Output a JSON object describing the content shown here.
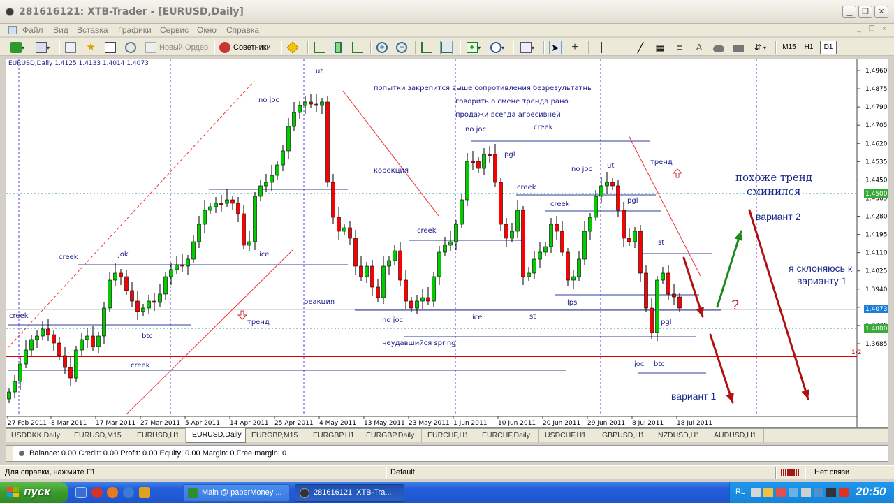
{
  "window": {
    "title": "281616121: XTB-Trader - [EURUSD,Daily]"
  },
  "menu": {
    "items": [
      "Файл",
      "Вид",
      "Вставка",
      "Графики",
      "Сервис",
      "Окно",
      "Справка"
    ]
  },
  "toolbar": {
    "new_order": "Новый Ордер",
    "experts": "Советники",
    "timeframes": [
      "M15",
      "H1",
      "D1"
    ],
    "active_timeframe": "D1"
  },
  "chart": {
    "info": "EURUSD,Daily  1.4125 1.4133 1.4014 1.4073",
    "price_axis": [
      "1.4960",
      "1.4875",
      "1.4790",
      "1.4705",
      "1.4620",
      "1.4535",
      "1.4450",
      "1.4365",
      "1.4280",
      "1.4195",
      "1.4110",
      "1.4025",
      "1.3940",
      "1.3855",
      "1.3770",
      "1.3685"
    ],
    "price_tags": {
      "level_4500": "1.4500",
      "current": "1.4073",
      "level_4000": "1.4000"
    },
    "half_marker": "1/2",
    "date_axis": [
      "27 Feb 2011",
      "8 Mar 2011",
      "17 Mar 2011",
      "27 Mar 2011",
      "5 Apr 2011",
      "14 Apr 2011",
      "25 Apr 2011",
      "4 May 2011",
      "13 May 2011",
      "23 May 2011",
      "1 Jun 2011",
      "10 Jun 2011",
      "20 Jun 2011",
      "29 Jun 2011",
      "8 Jul 2011",
      "18 Jul 2011"
    ],
    "annotations": {
      "ut1": "ut",
      "nojoc1": "no joc",
      "header1": "попытки закрепится выше сопротивления  безрезультатны",
      "header2": "говорить о смене тренда рано",
      "header3": "продажи всегда агресивней",
      "nojoc2": "no joc",
      "creek_top": "creek",
      "pgl1": "pgl",
      "nojoc3": "no joc",
      "ut2": "ut",
      "trend_right": "тренд",
      "korekcia": "корекция",
      "creek2": "creek",
      "creek3": "creek",
      "pgl2": "pgl",
      "creek_mid": "creek",
      "jok": "jok",
      "creek_left": "creek",
      "ice1": "ice",
      "st1": "st",
      "reakcia": "реакция",
      "trend_left": "тренд",
      "creek_low": "creek",
      "btc1": "btc",
      "nojoc4": "no joc",
      "ice2": "ice",
      "st2": "st",
      "lps": "lps",
      "pgl3": "pgl",
      "failed_spring": "неудавшийся spring",
      "creek_bottom": "creek",
      "joc": "joc",
      "btc2": "btc",
      "trend_changed": "похоже тренд сминился",
      "variant2": "вариант 2",
      "lean": "я склоняюсь к варианту 1",
      "variant1": "вариант 1",
      "question": "?"
    },
    "colors": {
      "bull": "#00cc00",
      "bear": "#ff0000",
      "grid": "#5a3fd6",
      "level_line": "#2e3d9e",
      "annotation_text": "#1a1a8a"
    }
  },
  "tabs": [
    "USDDKK,Daily",
    "EURUSD,M15",
    "EURUSD,H1",
    "EURUSD,Daily",
    "EURGBP,M15",
    "EURGBP,H1",
    "EURGBP,Daily",
    "EURCHF,H1",
    "EURCHF,Daily",
    "USDCHF,H1",
    "GBPUSD,H1",
    "NZDUSD,H1",
    "AUDUSD,H1"
  ],
  "active_tab": "EURUSD,Daily",
  "terminal": {
    "balance_line": "Balance: 0.00  Credit: 0.00  Profit: 0.00  Equity: 0.00  Margin: 0  Free margin: 0"
  },
  "status": {
    "help": "Для справки, нажмите F1",
    "profile": "Default",
    "connection": "Нет связи"
  },
  "taskbar": {
    "start": "пуск",
    "items": [
      "Main @ paperMoney ...",
      "281616121: XTB-Tra..."
    ],
    "lang": "RL",
    "clock": "20:50"
  }
}
